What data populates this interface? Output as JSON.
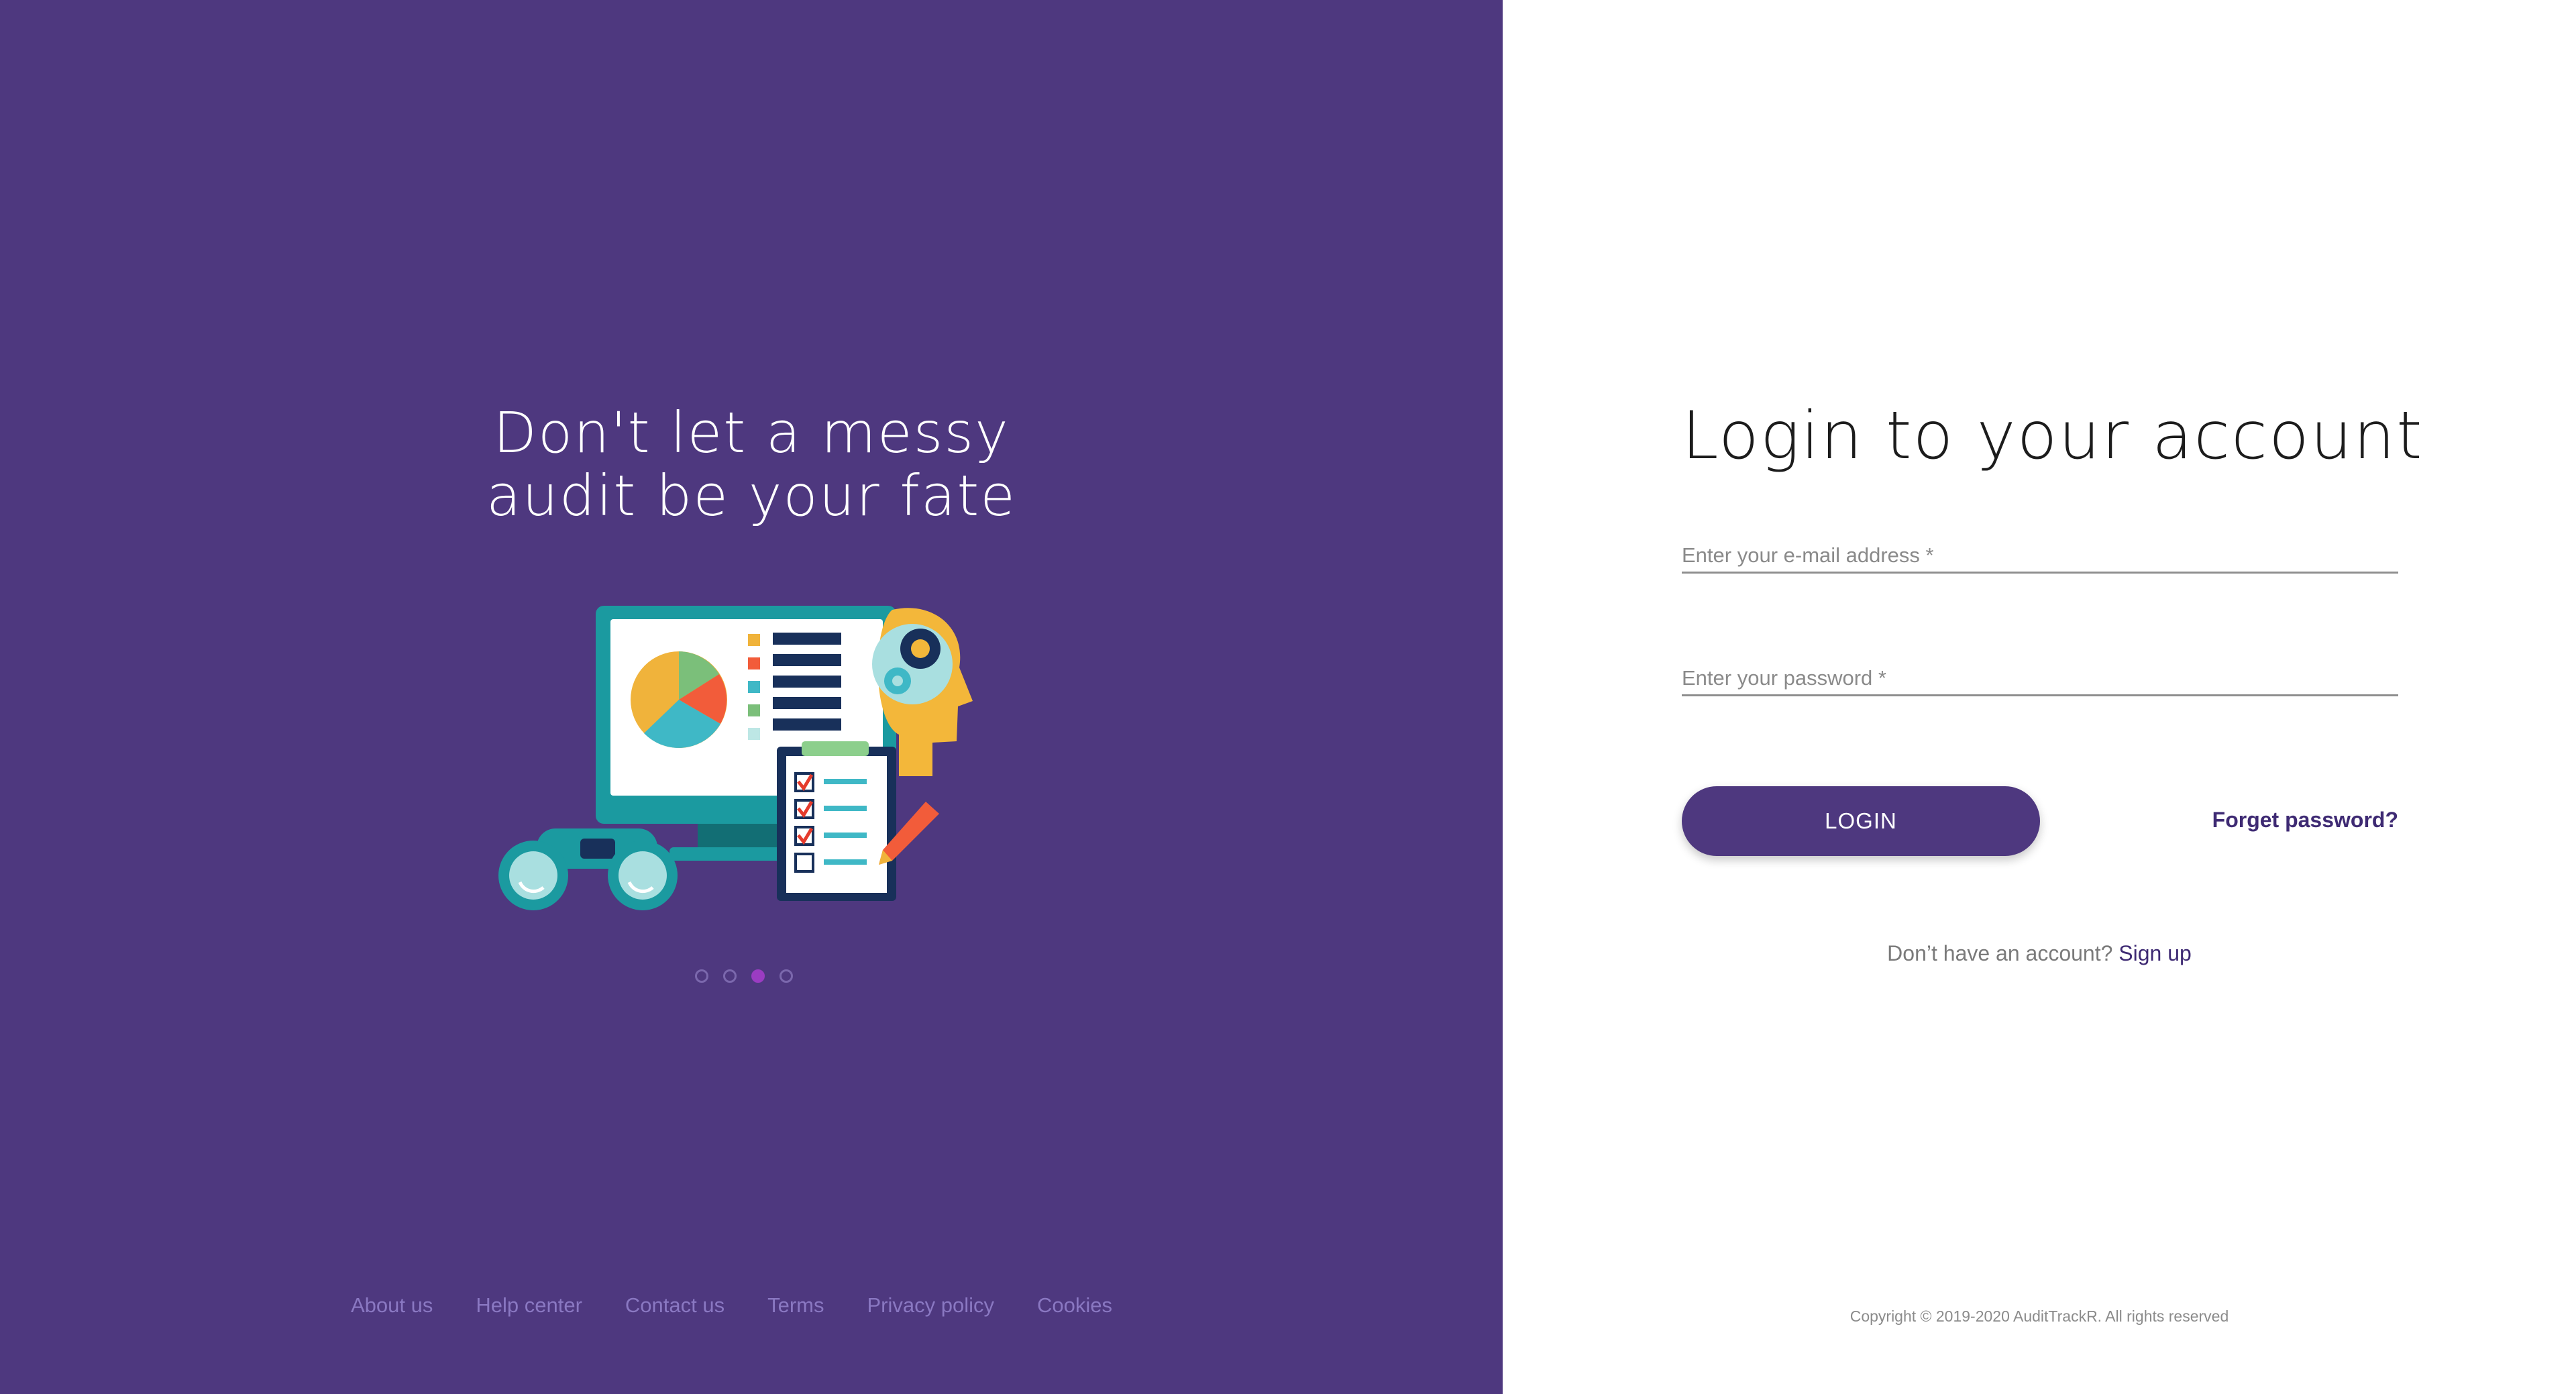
{
  "hero": {
    "headline_line1": "Don't let a messy",
    "headline_line2": "audit be your fate",
    "illustration_icon": "audit-illustration",
    "carousel": {
      "count": 4,
      "active_index": 2
    }
  },
  "footer": {
    "links": [
      "About us",
      "Help center",
      "Contact us",
      "Terms",
      "Privacy policy",
      "Cookies"
    ]
  },
  "login": {
    "title": "Login to your account",
    "email_placeholder": "Enter your e-mail address *",
    "password_placeholder": "Enter your password *",
    "login_button": "LOGIN",
    "forget_password": "Forget password?",
    "no_account_text": "Don’t have an account?",
    "signup_link": "Sign up",
    "copyright": "Copyright © 2019-2020 AuditTrackR. All rights reserved"
  },
  "colors": {
    "brand_purple": "#4e387f",
    "link_purple": "#3e2a73",
    "footer_link": "#8a78c2",
    "active_dot": "#9b3cc2"
  }
}
